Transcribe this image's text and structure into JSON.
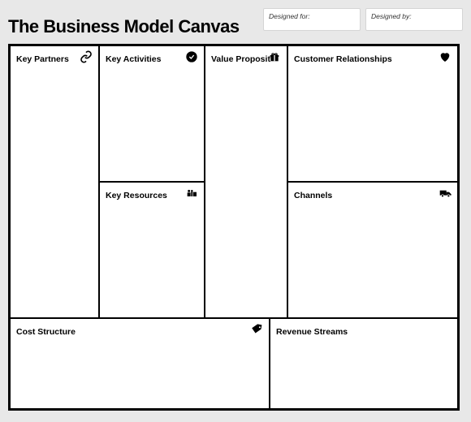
{
  "title": "The Business Model Canvas",
  "meta": {
    "designed_for_label": "Designed for:",
    "designed_by_label": "Designed by:"
  },
  "boxes": {
    "key_partners": {
      "label": "Key Partners",
      "icon": "link"
    },
    "key_activities": {
      "label": "Key Activities",
      "icon": "check-circle"
    },
    "key_resources": {
      "label": "Key Resources",
      "icon": "factory"
    },
    "value_proposition": {
      "label": "Value Proposit",
      "icon": "gift"
    },
    "customer_relationships": {
      "label": "Customer Relationships",
      "icon": "heart"
    },
    "channels": {
      "label": "Channels",
      "icon": "truck"
    },
    "cost_structure": {
      "label": "Cost Structure",
      "icon": "tag"
    },
    "revenue_streams": {
      "label": "Revenue Streams",
      "icon": ""
    }
  }
}
